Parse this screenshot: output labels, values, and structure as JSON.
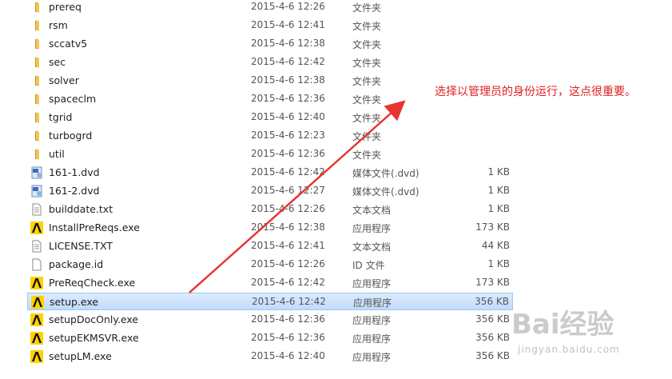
{
  "files": [
    {
      "name": "prereq",
      "date": "2015-4-6 12:26",
      "type": "文件夹",
      "size": "",
      "icon": "folder-icon"
    },
    {
      "name": "rsm",
      "date": "2015-4-6 12:41",
      "type": "文件夹",
      "size": "",
      "icon": "folder-icon"
    },
    {
      "name": "sccatv5",
      "date": "2015-4-6 12:38",
      "type": "文件夹",
      "size": "",
      "icon": "folder-icon"
    },
    {
      "name": "sec",
      "date": "2015-4-6 12:42",
      "type": "文件夹",
      "size": "",
      "icon": "folder-icon"
    },
    {
      "name": "solver",
      "date": "2015-4-6 12:38",
      "type": "文件夹",
      "size": "",
      "icon": "folder-icon"
    },
    {
      "name": "spaceclm",
      "date": "2015-4-6 12:36",
      "type": "文件夹",
      "size": "",
      "icon": "folder-icon"
    },
    {
      "name": "tgrid",
      "date": "2015-4-6 12:40",
      "type": "文件夹",
      "size": "",
      "icon": "folder-icon"
    },
    {
      "name": "turbogrd",
      "date": "2015-4-6 12:23",
      "type": "文件夹",
      "size": "",
      "icon": "folder-icon"
    },
    {
      "name": "util",
      "date": "2015-4-6 12:36",
      "type": "文件夹",
      "size": "",
      "icon": "folder-icon"
    },
    {
      "name": "161-1.dvd",
      "date": "2015-4-6 12:42",
      "type": "媒体文件(.dvd)",
      "size": "1 KB",
      "icon": "media-file-icon"
    },
    {
      "name": "161-2.dvd",
      "date": "2015-4-6 12:27",
      "type": "媒体文件(.dvd)",
      "size": "1 KB",
      "icon": "media-file-icon"
    },
    {
      "name": "builddate.txt",
      "date": "2015-4-6 12:26",
      "type": "文本文档",
      "size": "1 KB",
      "icon": "text-file-icon"
    },
    {
      "name": "InstallPreReqs.exe",
      "date": "2015-4-6 12:38",
      "type": "应用程序",
      "size": "173 KB",
      "icon": "ansys-app-icon"
    },
    {
      "name": "LICENSE.TXT",
      "date": "2015-4-6 12:41",
      "type": "文本文档",
      "size": "44 KB",
      "icon": "text-file-icon"
    },
    {
      "name": "package.id",
      "date": "2015-4-6 12:26",
      "type": "ID 文件",
      "size": "1 KB",
      "icon": "blank-file-icon"
    },
    {
      "name": "PreReqCheck.exe",
      "date": "2015-4-6 12:42",
      "type": "应用程序",
      "size": "173 KB",
      "icon": "ansys-app-icon"
    },
    {
      "name": "setup.exe",
      "date": "2015-4-6 12:42",
      "type": "应用程序",
      "size": "356 KB",
      "icon": "ansys-app-icon",
      "selected": true
    },
    {
      "name": "setupDocOnly.exe",
      "date": "2015-4-6 12:36",
      "type": "应用程序",
      "size": "356 KB",
      "icon": "ansys-app-icon"
    },
    {
      "name": "setupEKMSVR.exe",
      "date": "2015-4-6 12:36",
      "type": "应用程序",
      "size": "356 KB",
      "icon": "ansys-app-icon"
    },
    {
      "name": "setupLM.exe",
      "date": "2015-4-6 12:40",
      "type": "应用程序",
      "size": "356 KB",
      "icon": "ansys-app-icon"
    }
  ],
  "annotation": {
    "text": "选择以管理员的身份运行，这点很重要。",
    "color": "#e02020"
  },
  "watermark": {
    "logo": "Bai经验",
    "sub": "jingyan.baidu.com"
  },
  "colors": {
    "folder": "#e8b64a",
    "selection": "#cce8ff",
    "arrow": "#e8332f"
  }
}
